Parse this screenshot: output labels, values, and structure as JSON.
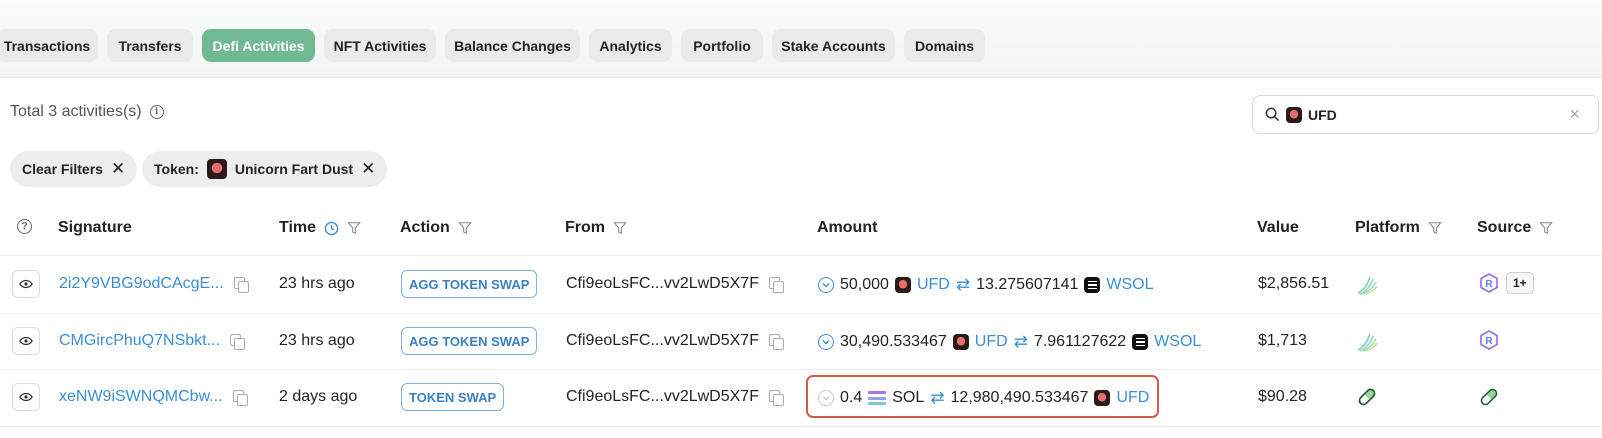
{
  "tabs": [
    "Transactions",
    "Transfers",
    "Defi Activities",
    "NFT Activities",
    "Balance Changes",
    "Analytics",
    "Portfolio",
    "Stake Accounts",
    "Domains"
  ],
  "active_tab": "Defi Activities",
  "summary": {
    "total_text": "Total 3 activities(s)"
  },
  "search": {
    "value": "UFD"
  },
  "filters": {
    "clear_label": "Clear Filters",
    "token_prefix": "Token:",
    "token_name": "Unicorn Fart Dust"
  },
  "columns": {
    "signature": "Signature",
    "time": "Time",
    "action": "Action",
    "from": "From",
    "amount": "Amount",
    "value": "Value",
    "platform": "Platform",
    "source": "Source"
  },
  "rows": [
    {
      "signature": "2i2Y9VBG9odCAcgE...",
      "time": "23 hrs ago",
      "action": "AGG TOKEN SWAP",
      "from": "Cfi9eoLsFC...vv2LwD5X7F",
      "amount_in": "50,000",
      "token_in": "UFD",
      "amount_out": "13.275607141",
      "token_out": "WSOL",
      "value": "$2,856.51",
      "source_more": "1+"
    },
    {
      "signature": "CMGircPhuQ7NSbkt...",
      "time": "23 hrs ago",
      "action": "AGG TOKEN SWAP",
      "from": "Cfi9eoLsFC...vv2LwD5X7F",
      "amount_in": "30,490.533467",
      "token_in": "UFD",
      "amount_out": "7.961127622",
      "token_out": "WSOL",
      "value": "$1,713"
    },
    {
      "signature": "xeNW9iSWNQMCbw...",
      "time": "2 days ago",
      "action": "TOKEN SWAP",
      "from": "Cfi9eoLsFC...vv2LwD5X7F",
      "amount_in": "0.4",
      "token_in": "SOL",
      "amount_out": "12,980,490.533467",
      "token_out": "UFD",
      "value": "$90.28"
    }
  ],
  "colors": {
    "accent": "#6fba95",
    "link": "#3b8ed6",
    "highlight": "#d65a44"
  }
}
